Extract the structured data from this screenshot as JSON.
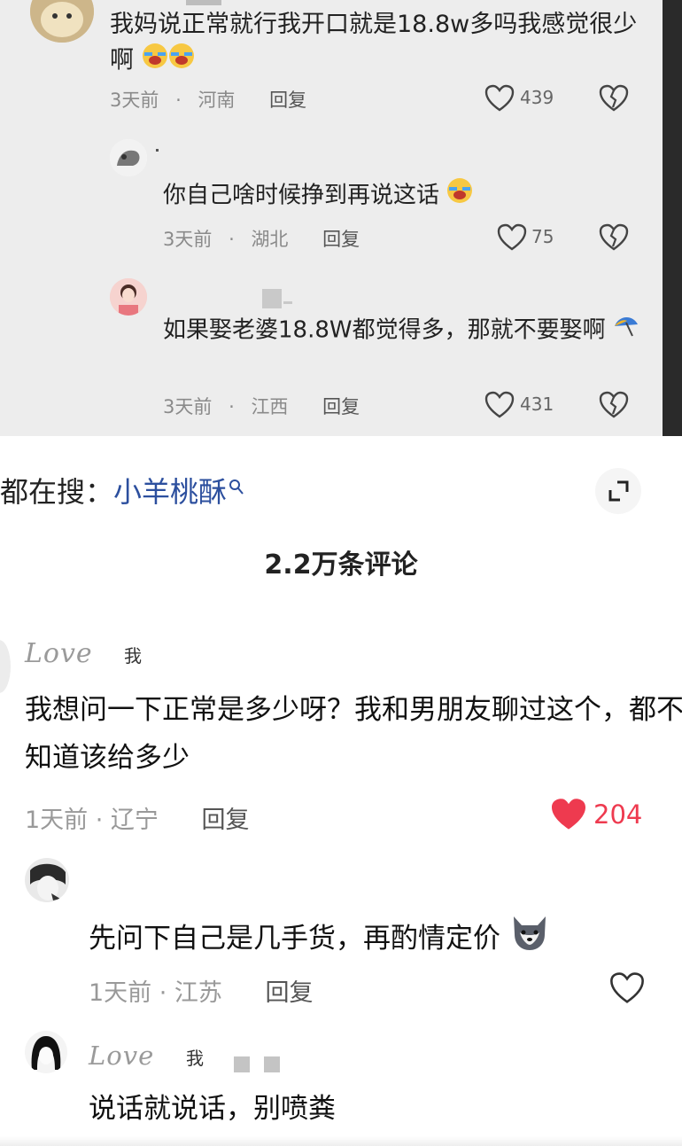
{
  "top": {
    "c1": {
      "text": "我妈说正常就行我开口就是18.8w多吗我感觉很少啊",
      "time": "3天前",
      "loc": "河南",
      "reply": "回复",
      "likes": "439"
    },
    "c2": {
      "text": "你自己啥时候挣到再说这话",
      "time": "3天前",
      "loc": "湖北",
      "reply": "回复",
      "likes": "75"
    },
    "c3": {
      "text": "如果娶老婆18.8W都觉得多，那就不要娶啊",
      "time": "3天前",
      "loc": "江西",
      "reply": "回复",
      "likes": "431"
    },
    "sep": "·"
  },
  "search": {
    "prefix": "都在搜：",
    "keyword": "小羊桃酥"
  },
  "comment_count": "2.2万条评论",
  "main": {
    "c1": {
      "name": "Love",
      "badge": "我",
      "text": "我想问一下正常是多少呀？我和男朋友聊过这个，都不知道该给多少",
      "meta": "1天前 · 辽宁",
      "reply": "回复",
      "likes": "204",
      "liked_color": "#ee3a4f"
    },
    "c2": {
      "text": "先问下自己是几手货，再酌情定价",
      "meta": "1天前 · 江苏",
      "reply": "回复"
    },
    "c3": {
      "name": "Love",
      "badge": "我",
      "text": "说话就说话，别喷粪"
    }
  }
}
